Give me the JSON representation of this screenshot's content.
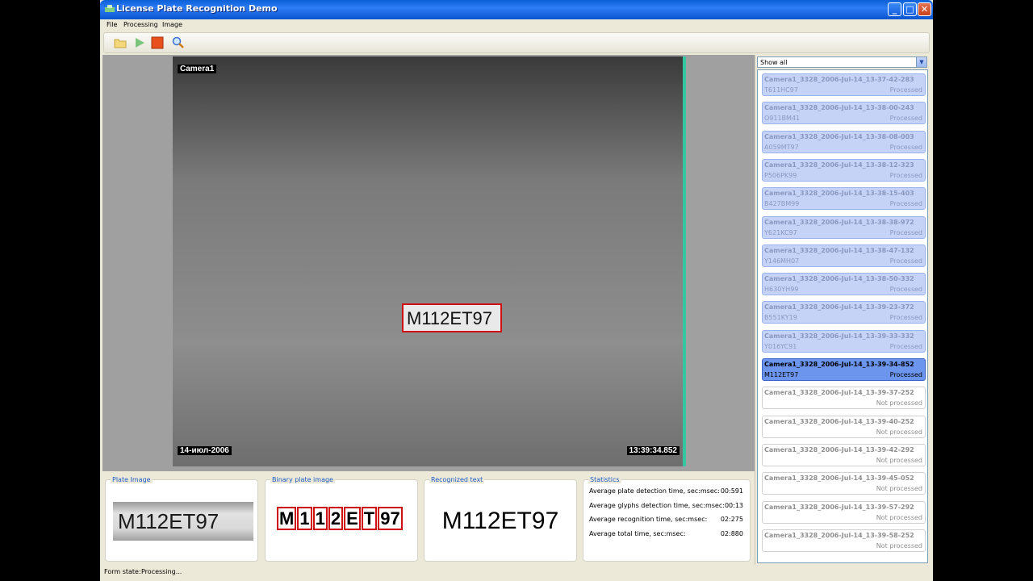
{
  "window": {
    "title": "License Plate Recognition Demo"
  },
  "menu": {
    "file": "File",
    "processing": "Processing",
    "image": "Image"
  },
  "toolbar": {
    "icons": [
      "folder-open-icon",
      "play-icon",
      "stop-icon",
      "zoom-icon"
    ]
  },
  "viewer": {
    "camera_label": "Camera1",
    "date_label": "14-июл-2006",
    "time_label": "13:39:34.852",
    "plate_text": "M112ET97"
  },
  "filter": {
    "selected": "Show all"
  },
  "list": [
    {
      "name": "Camera1_3328_2006-Jul-14_13-37-42-283",
      "plate": "T611HC97",
      "status": "Processed",
      "state": "proc"
    },
    {
      "name": "Camera1_3328_2006-Jul-14_13-38-00-243",
      "plate": "O911BM41",
      "status": "Processed",
      "state": "proc"
    },
    {
      "name": "Camera1_3328_2006-Jul-14_13-38-08-003",
      "plate": "A059MT97",
      "status": "Processed",
      "state": "proc"
    },
    {
      "name": "Camera1_3328_2006-Jul-14_13-38-12-323",
      "plate": "P506PK99",
      "status": "Processed",
      "state": "proc"
    },
    {
      "name": "Camera1_3328_2006-Jul-14_13-38-15-403",
      "plate": "B427BM99",
      "status": "Processed",
      "state": "proc"
    },
    {
      "name": "Camera1_3328_2006-Jul-14_13-38-38-972",
      "plate": "Y621KC97",
      "status": "Processed",
      "state": "proc"
    },
    {
      "name": "Camera1_3328_2006-Jul-14_13-38-47-132",
      "plate": "Y146MH07",
      "status": "Processed",
      "state": "proc"
    },
    {
      "name": "Camera1_3328_2006-Jul-14_13-38-50-332",
      "plate": "H630YH99",
      "status": "Processed",
      "state": "proc"
    },
    {
      "name": "Camera1_3328_2006-Jul-14_13-39-23-372",
      "plate": "B551KY19",
      "status": "Processed",
      "state": "proc"
    },
    {
      "name": "Camera1_3328_2006-Jul-14_13-39-33-332",
      "plate": "Y016YC91",
      "status": "Processed",
      "state": "proc"
    },
    {
      "name": "Camera1_3328_2006-Jul-14_13-39-34-852",
      "plate": "M112ET97",
      "status": "Processed",
      "state": "sel"
    },
    {
      "name": "Camera1_3328_2006-Jul-14_13-39-37-252",
      "plate": "",
      "status": "Not processed",
      "state": "np"
    },
    {
      "name": "Camera1_3328_2006-Jul-14_13-39-40-252",
      "plate": "",
      "status": "Not processed",
      "state": "np"
    },
    {
      "name": "Camera1_3328_2006-Jul-14_13-39-42-292",
      "plate": "",
      "status": "Not processed",
      "state": "np"
    },
    {
      "name": "Camera1_3328_2006-Jul-14_13-39-45-052",
      "plate": "",
      "status": "Not processed",
      "state": "np"
    },
    {
      "name": "Camera1_3328_2006-Jul-14_13-39-57-292",
      "plate": "",
      "status": "Not processed",
      "state": "np"
    },
    {
      "name": "Camera1_3328_2006-Jul-14_13-39-58-252",
      "plate": "",
      "status": "Not processed",
      "state": "np"
    }
  ],
  "panels": {
    "plate_image": {
      "title": "Plate Image",
      "text": "M112ET97"
    },
    "binary_image": {
      "title": "Binary plate image",
      "glyphs": [
        "M",
        "1",
        "1",
        "2",
        "E",
        "T",
        "97"
      ]
    },
    "recognized": {
      "title": "Recognized text",
      "text": "M112ET97"
    },
    "statistics": {
      "title": "Statistics",
      "rows": [
        {
          "label": "Average plate detection time, sec:msec:",
          "value": "00:591"
        },
        {
          "label": "Average glyphs detection time, sec:msec:",
          "value": "00:13"
        },
        {
          "label": "Average recognition time, sec:msec:",
          "value": "02:275"
        },
        {
          "label": "Average total time, sec:msec:",
          "value": "02:880"
        }
      ]
    }
  },
  "status": {
    "label": "Form state:",
    "value": "Processing..."
  },
  "colors": {
    "accent": "#0a5fd8",
    "selected": "#6c95ee",
    "processed": "#c5d3f7",
    "plate_box": "#d01010"
  }
}
